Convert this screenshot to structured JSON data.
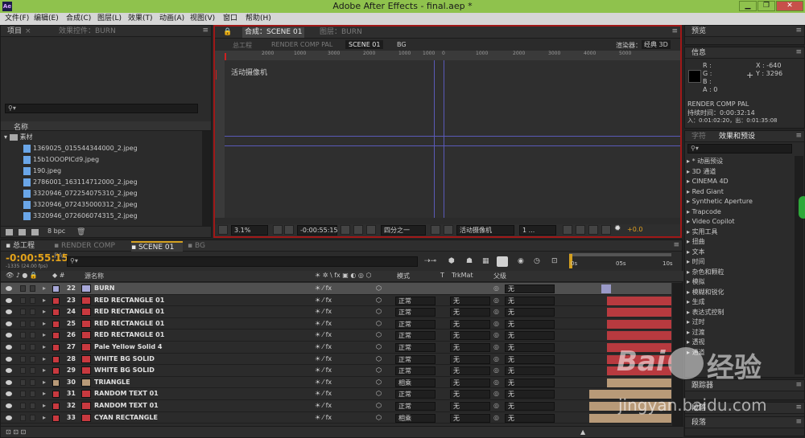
{
  "window": {
    "title": "Adobe After Effects - final.aep *",
    "app_icon": "Ae",
    "controls": [
      "0",
      "1",
      "r"
    ]
  },
  "menu": [
    "文件(F)",
    "编辑(E)",
    "合成(C)",
    "图层(L)",
    "效果(T)",
    "动画(A)",
    "视图(V)",
    "窗口",
    "帮助(H)"
  ],
  "project": {
    "tab": "项目",
    "tab_close": "×",
    "effects_tab": "效果控件：BURN",
    "column_name": "名称",
    "folder": "素材",
    "files": [
      "1369025_015544344000_2.jpeg",
      "15b1OOOPICd9.jpeg",
      "190.jpeg",
      "2786001_163114712000_2.jpeg",
      "3320946_072254075310_2.jpeg",
      "3320946_072435000312_2.jpeg",
      "3320946_072606074315_2.jpeg"
    ],
    "bpc": "8 bpc"
  },
  "composition": {
    "tab": "合成：SCENE 01",
    "layer_tab": "图层：BURN",
    "flow": [
      "总工程",
      "RENDER COMP PAL",
      "SCENE 01",
      "BG"
    ],
    "renderer_label": "渲染器：",
    "renderer": "经典 3D",
    "camera_label": "活动摄像机",
    "ruler": [
      "2000",
      "1000",
      "3000",
      "2000",
      "1000",
      "1000",
      "0",
      "1000",
      "2000",
      "3000",
      "4000",
      "5000"
    ],
    "zoom": "3.1%",
    "timecode": "-0:00:55:15",
    "resolution": "四分之一",
    "camera_select": "活动摄像机",
    "view_select": "1 ...",
    "exposure": "+0.0"
  },
  "preview": {
    "tab": "预览"
  },
  "info": {
    "tab": "信息",
    "r": "R :",
    "g": "G :",
    "b": "B :",
    "a": "A : 0",
    "x": "X : -640",
    "y": "Y : 3296",
    "comp": "RENDER COMP PAL",
    "duration": "持续时间：0:00:32:14",
    "inout": "入：0:01:02:20，出：0:01:35:08"
  },
  "char": {
    "tab": "字符"
  },
  "effects": {
    "tab": "效果和预设",
    "items": [
      "* 动画预设",
      "3D 通道",
      "CINEMA 4D",
      "Red Giant",
      "Synthetic Aperture",
      "Trapcode",
      "Video Copilot",
      "实用工具",
      "扭曲",
      "文本",
      "时间",
      "杂色和颗粒",
      "模拟",
      "模糊和锐化",
      "生成",
      "表达式控制",
      "过时",
      "过渡",
      "透视",
      "通道"
    ]
  },
  "tracker": {
    "tab": "跟踪器"
  },
  "smoother": {
    "tab": "段落"
  },
  "timeline": {
    "tabs": [
      "总工程",
      "RENDER COMP PAL",
      "SCENE 01",
      "BG"
    ],
    "timecode": "-0:00:55:15",
    "frames": "-1335 (24.00 fps)",
    "header": {
      "name": "源名称",
      "mode": "模式",
      "t": "T",
      "trkmat": "TrkMat",
      "parent": "父级"
    },
    "ruler": [
      "0s",
      "05s",
      "10s"
    ],
    "layers": [
      {
        "num": "22",
        "name": "BURN",
        "color": "#a8a8d8",
        "mode": "",
        "trk": "",
        "parent": "无",
        "bar": "#9a9ac8",
        "selected": true
      },
      {
        "num": "23",
        "name": "RED RECTANGLE 01",
        "color": "#c8393f",
        "mode": "正常",
        "trk": "无",
        "parent": "无",
        "bar": "#b83a3f"
      },
      {
        "num": "24",
        "name": "RED RECTANGLE 01",
        "color": "#c8393f",
        "mode": "正常",
        "trk": "无",
        "parent": "无",
        "bar": "#b83a3f"
      },
      {
        "num": "25",
        "name": "RED RECTANGLE 01",
        "color": "#c8393f",
        "mode": "正常",
        "trk": "无",
        "parent": "无",
        "bar": "#b83a3f"
      },
      {
        "num": "26",
        "name": "RED RECTANGLE 01",
        "color": "#c8393f",
        "mode": "正常",
        "trk": "无",
        "parent": "无",
        "bar": "#b83a3f"
      },
      {
        "num": "27",
        "name": "Pale Yellow Solid 4",
        "color": "#c8393f",
        "mode": "正常",
        "trk": "无",
        "parent": "无",
        "bar": "#b83a3f"
      },
      {
        "num": "28",
        "name": "WHITE BG SOLID",
        "color": "#c8393f",
        "mode": "正常",
        "trk": "无",
        "parent": "无",
        "bar": "#b83a3f"
      },
      {
        "num": "29",
        "name": "WHITE BG SOLID",
        "color": "#c8393f",
        "mode": "正常",
        "trk": "无",
        "parent": "无",
        "bar": "#b83a3f"
      },
      {
        "num": "30",
        "name": "TRIANGLE",
        "color": "#b89a78",
        "mode": "相乘",
        "trk": "无",
        "parent": "无",
        "bar": "#b89a78"
      },
      {
        "num": "31",
        "name": "RANDOM TEXT 01",
        "color": "#c8393f",
        "mode": "正常",
        "trk": "无",
        "parent": "无",
        "bar": "#b89a78"
      },
      {
        "num": "32",
        "name": "RANDOM TEXT 01",
        "color": "#c8393f",
        "mode": "正常",
        "trk": "无",
        "parent": "无",
        "bar": "#b89a78"
      },
      {
        "num": "33",
        "name": "CYAN RECTANGLE",
        "color": "#c8393f",
        "mode": "相乘",
        "trk": "无",
        "parent": "无",
        "bar": "#b89a78"
      }
    ]
  },
  "watermark": {
    "brand": "Bai",
    "brand2": "经验",
    "url": "jingyan.baidu.com"
  }
}
